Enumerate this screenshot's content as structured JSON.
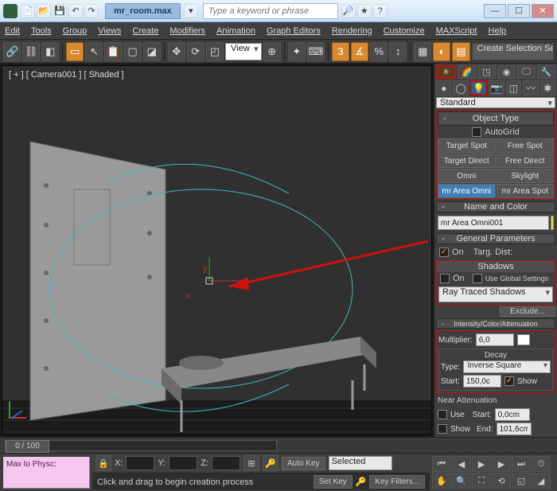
{
  "title": {
    "filename": "mr_room.max",
    "search_placeholder": "Type a keyword or phrase"
  },
  "menu": {
    "items": [
      "Edit",
      "Tools",
      "Group",
      "Views",
      "Create",
      "Modifiers",
      "Animation",
      "Graph Editors",
      "Rendering",
      "Customize",
      "MAXScript",
      "Help"
    ]
  },
  "toolbar": {
    "view_selector": "View",
    "create_selection_label": "Create Selection Se"
  },
  "viewport": {
    "label": "[ + ] [ Camera001 ] [ Shaded ]"
  },
  "cmd": {
    "create_dd": "Standard",
    "objtype_title": "Object Type",
    "autogrid": "AutoGrid",
    "buttons": {
      "r0c0": "Target Spot",
      "r0c1": "Free Spot",
      "r1c0": "Target Direct",
      "r1c1": "Free Direct",
      "r2c0": "Omni",
      "r2c1": "Skylight",
      "r3c0": "mr Area Omni",
      "r3c1": "mr Area Spot"
    },
    "namecolor_title": "Name and Color",
    "name_value": "mr Area Omni001",
    "genparam_title": "General Parameters",
    "on_label": "On",
    "targdist_label": "Targ. Dist:",
    "shadows_label": "Shadows",
    "useglobal_label": "Use Global Settings",
    "shadow_type": "Ray Traced Shadows",
    "exclude_label": "Exclude...",
    "inten_title": "Intensity/Color/Attenuation",
    "multiplier_label": "Multiplier:",
    "multiplier_value": "6,0",
    "decay_label": "Decay",
    "decay_type_label": "Type:",
    "decay_type_value": "Inverse Square",
    "decay_start_label": "Start:",
    "decay_start_value": "150,0c",
    "show_label": "Show",
    "nearatt_label": "Near Attenuation",
    "use_label": "Use",
    "start_label": "Start:",
    "end_label": "End:",
    "start_value": "0,0cm",
    "end_value": "101,6cm"
  },
  "timeline": {
    "frame": "0 / 100"
  },
  "status": {
    "script_label": "Max to Physc:",
    "x_label": "X:",
    "y_label": "Y:",
    "z_label": "Z:",
    "autokey": "Auto Key",
    "setkey": "Set Key",
    "selected": "Selected",
    "keyfilters": "Key Filters...",
    "prompt": "Click and drag to begin creation process"
  }
}
